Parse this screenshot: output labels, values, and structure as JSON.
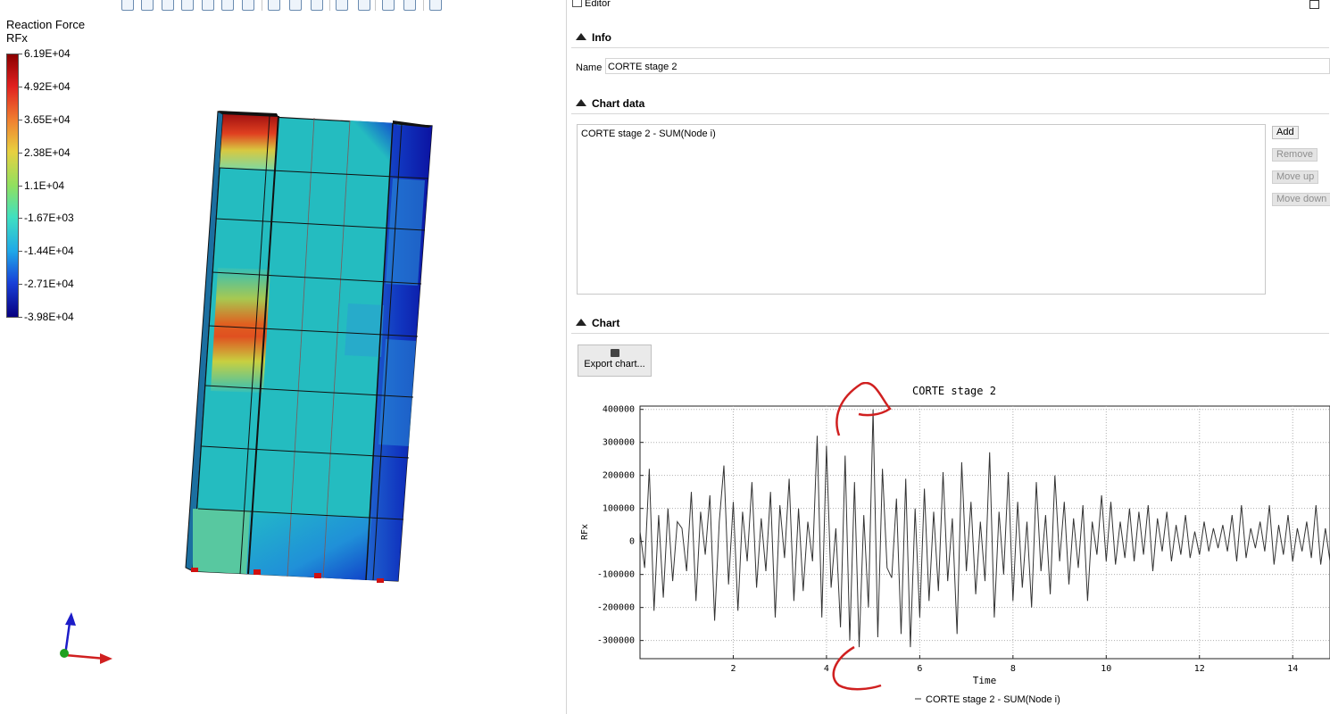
{
  "legend": {
    "title_line1": "Reaction Force",
    "title_line2": "RFx",
    "labels": [
      "6.19E+04",
      "4.92E+04",
      "3.65E+04",
      "2.38E+04",
      "1.1E+04",
      "-1.67E+03",
      "-1.44E+04",
      "-2.71E+04",
      "-3.98E+04"
    ]
  },
  "toolbar_icons": [
    "view-cube-icon",
    "view-front-icon",
    "view-back-icon",
    "view-left-icon",
    "view-right-icon",
    "view-top-icon",
    "view-bottom-icon",
    "eye-icon",
    "eye-icon",
    "eye-hide-icon",
    "road-icon",
    "pillar-icon",
    "zoom-icon",
    "zoom-in-icon",
    "grid-icon"
  ],
  "editor": {
    "title": "Editor",
    "info_label": "Info",
    "name_label": "Name",
    "name_value": "CORTE  stage 2",
    "chart_data_label": "Chart data",
    "list_items": [
      "CORTE  stage 2 - SUM(Node i)"
    ],
    "buttons": {
      "add": "Add",
      "remove": "Remove",
      "move_up": "Move up",
      "move_down": "Move down"
    },
    "chart_label": "Chart",
    "export_label": "Export chart..."
  },
  "colors": {
    "accent_red": "#d02020",
    "axis_blue": "#1c1cc8",
    "axis_green": "#1fa01f",
    "legend_border": "#555555"
  },
  "chart_data": {
    "type": "line",
    "title": "CORTE  stage 2",
    "xlabel": "Time",
    "ylabel": "RFx",
    "xlim": [
      0,
      14.8
    ],
    "ylim": [
      -355000,
      410000
    ],
    "xticks": [
      2,
      4,
      6,
      8,
      10,
      12,
      14
    ],
    "yticks": [
      -300000,
      -200000,
      -100000,
      0,
      100000,
      200000,
      300000,
      400000
    ],
    "ytick_labels": [
      "-300000",
      "-200000",
      "-100000",
      "0",
      "100000",
      "200000",
      "300000",
      "400000"
    ],
    "grid": true,
    "legend_position": "bottom",
    "series": [
      {
        "name": "CORTE  stage 2 - SUM(Node i)",
        "x": [
          0.0,
          0.1,
          0.2,
          0.3,
          0.4,
          0.5,
          0.6,
          0.7,
          0.8,
          0.9,
          1.0,
          1.1,
          1.2,
          1.3,
          1.4,
          1.5,
          1.6,
          1.7,
          1.8,
          1.9,
          2.0,
          2.1,
          2.2,
          2.3,
          2.4,
          2.5,
          2.6,
          2.7,
          2.8,
          2.9,
          3.0,
          3.1,
          3.2,
          3.3,
          3.4,
          3.5,
          3.6,
          3.7,
          3.8,
          3.9,
          4.0,
          4.1,
          4.2,
          4.3,
          4.4,
          4.5,
          4.6,
          4.7,
          4.8,
          4.9,
          5.0,
          5.1,
          5.2,
          5.3,
          5.4,
          5.5,
          5.6,
          5.7,
          5.8,
          5.9,
          6.0,
          6.1,
          6.2,
          6.3,
          6.4,
          6.5,
          6.6,
          6.7,
          6.8,
          6.9,
          7.0,
          7.1,
          7.2,
          7.3,
          7.4,
          7.5,
          7.6,
          7.7,
          7.8,
          7.9,
          8.0,
          8.1,
          8.2,
          8.3,
          8.4,
          8.5,
          8.6,
          8.7,
          8.8,
          8.9,
          9.0,
          9.1,
          9.2,
          9.3,
          9.4,
          9.5,
          9.6,
          9.7,
          9.8,
          9.9,
          10.0,
          10.1,
          10.2,
          10.3,
          10.4,
          10.5,
          10.6,
          10.7,
          10.8,
          10.9,
          11.0,
          11.1,
          11.2,
          11.3,
          11.4,
          11.5,
          11.6,
          11.7,
          11.8,
          11.9,
          12.0,
          12.1,
          12.2,
          12.3,
          12.4,
          12.5,
          12.6,
          12.7,
          12.8,
          12.9,
          13.0,
          13.1,
          13.2,
          13.3,
          13.4,
          13.5,
          13.6,
          13.7,
          13.8,
          13.9,
          14.0,
          14.1,
          14.2,
          14.3,
          14.4,
          14.5,
          14.6,
          14.7,
          14.8
        ],
        "values": [
          30000,
          -80000,
          220000,
          -210000,
          80000,
          -170000,
          100000,
          -120000,
          60000,
          40000,
          -90000,
          150000,
          -180000,
          90000,
          -40000,
          140000,
          -240000,
          60000,
          230000,
          -130000,
          120000,
          -210000,
          90000,
          -60000,
          180000,
          -140000,
          70000,
          -90000,
          150000,
          -230000,
          110000,
          -50000,
          190000,
          -180000,
          100000,
          -150000,
          60000,
          -60000,
          320000,
          -230000,
          290000,
          -140000,
          40000,
          -260000,
          260000,
          -300000,
          180000,
          -320000,
          80000,
          -200000,
          400000,
          -290000,
          220000,
          -80000,
          -110000,
          130000,
          -280000,
          190000,
          -320000,
          100000,
          -230000,
          160000,
          -180000,
          90000,
          -150000,
          210000,
          -120000,
          70000,
          -280000,
          240000,
          -90000,
          120000,
          -160000,
          60000,
          -120000,
          270000,
          -230000,
          90000,
          -100000,
          210000,
          -180000,
          120000,
          -140000,
          60000,
          -200000,
          180000,
          -90000,
          80000,
          -160000,
          200000,
          -60000,
          120000,
          -130000,
          70000,
          -80000,
          110000,
          -180000,
          60000,
          -40000,
          140000,
          -60000,
          120000,
          -70000,
          60000,
          -50000,
          100000,
          -60000,
          90000,
          -40000,
          110000,
          -90000,
          70000,
          -30000,
          90000,
          -60000,
          50000,
          -40000,
          80000,
          -50000,
          30000,
          -40000,
          60000,
          -30000,
          40000,
          -20000,
          50000,
          -30000,
          80000,
          -60000,
          110000,
          -50000,
          40000,
          -20000,
          60000,
          -30000,
          110000,
          -70000,
          50000,
          -40000,
          80000,
          -60000,
          40000,
          -30000,
          60000,
          -50000,
          110000,
          -70000,
          40000,
          -60000
        ]
      }
    ]
  }
}
